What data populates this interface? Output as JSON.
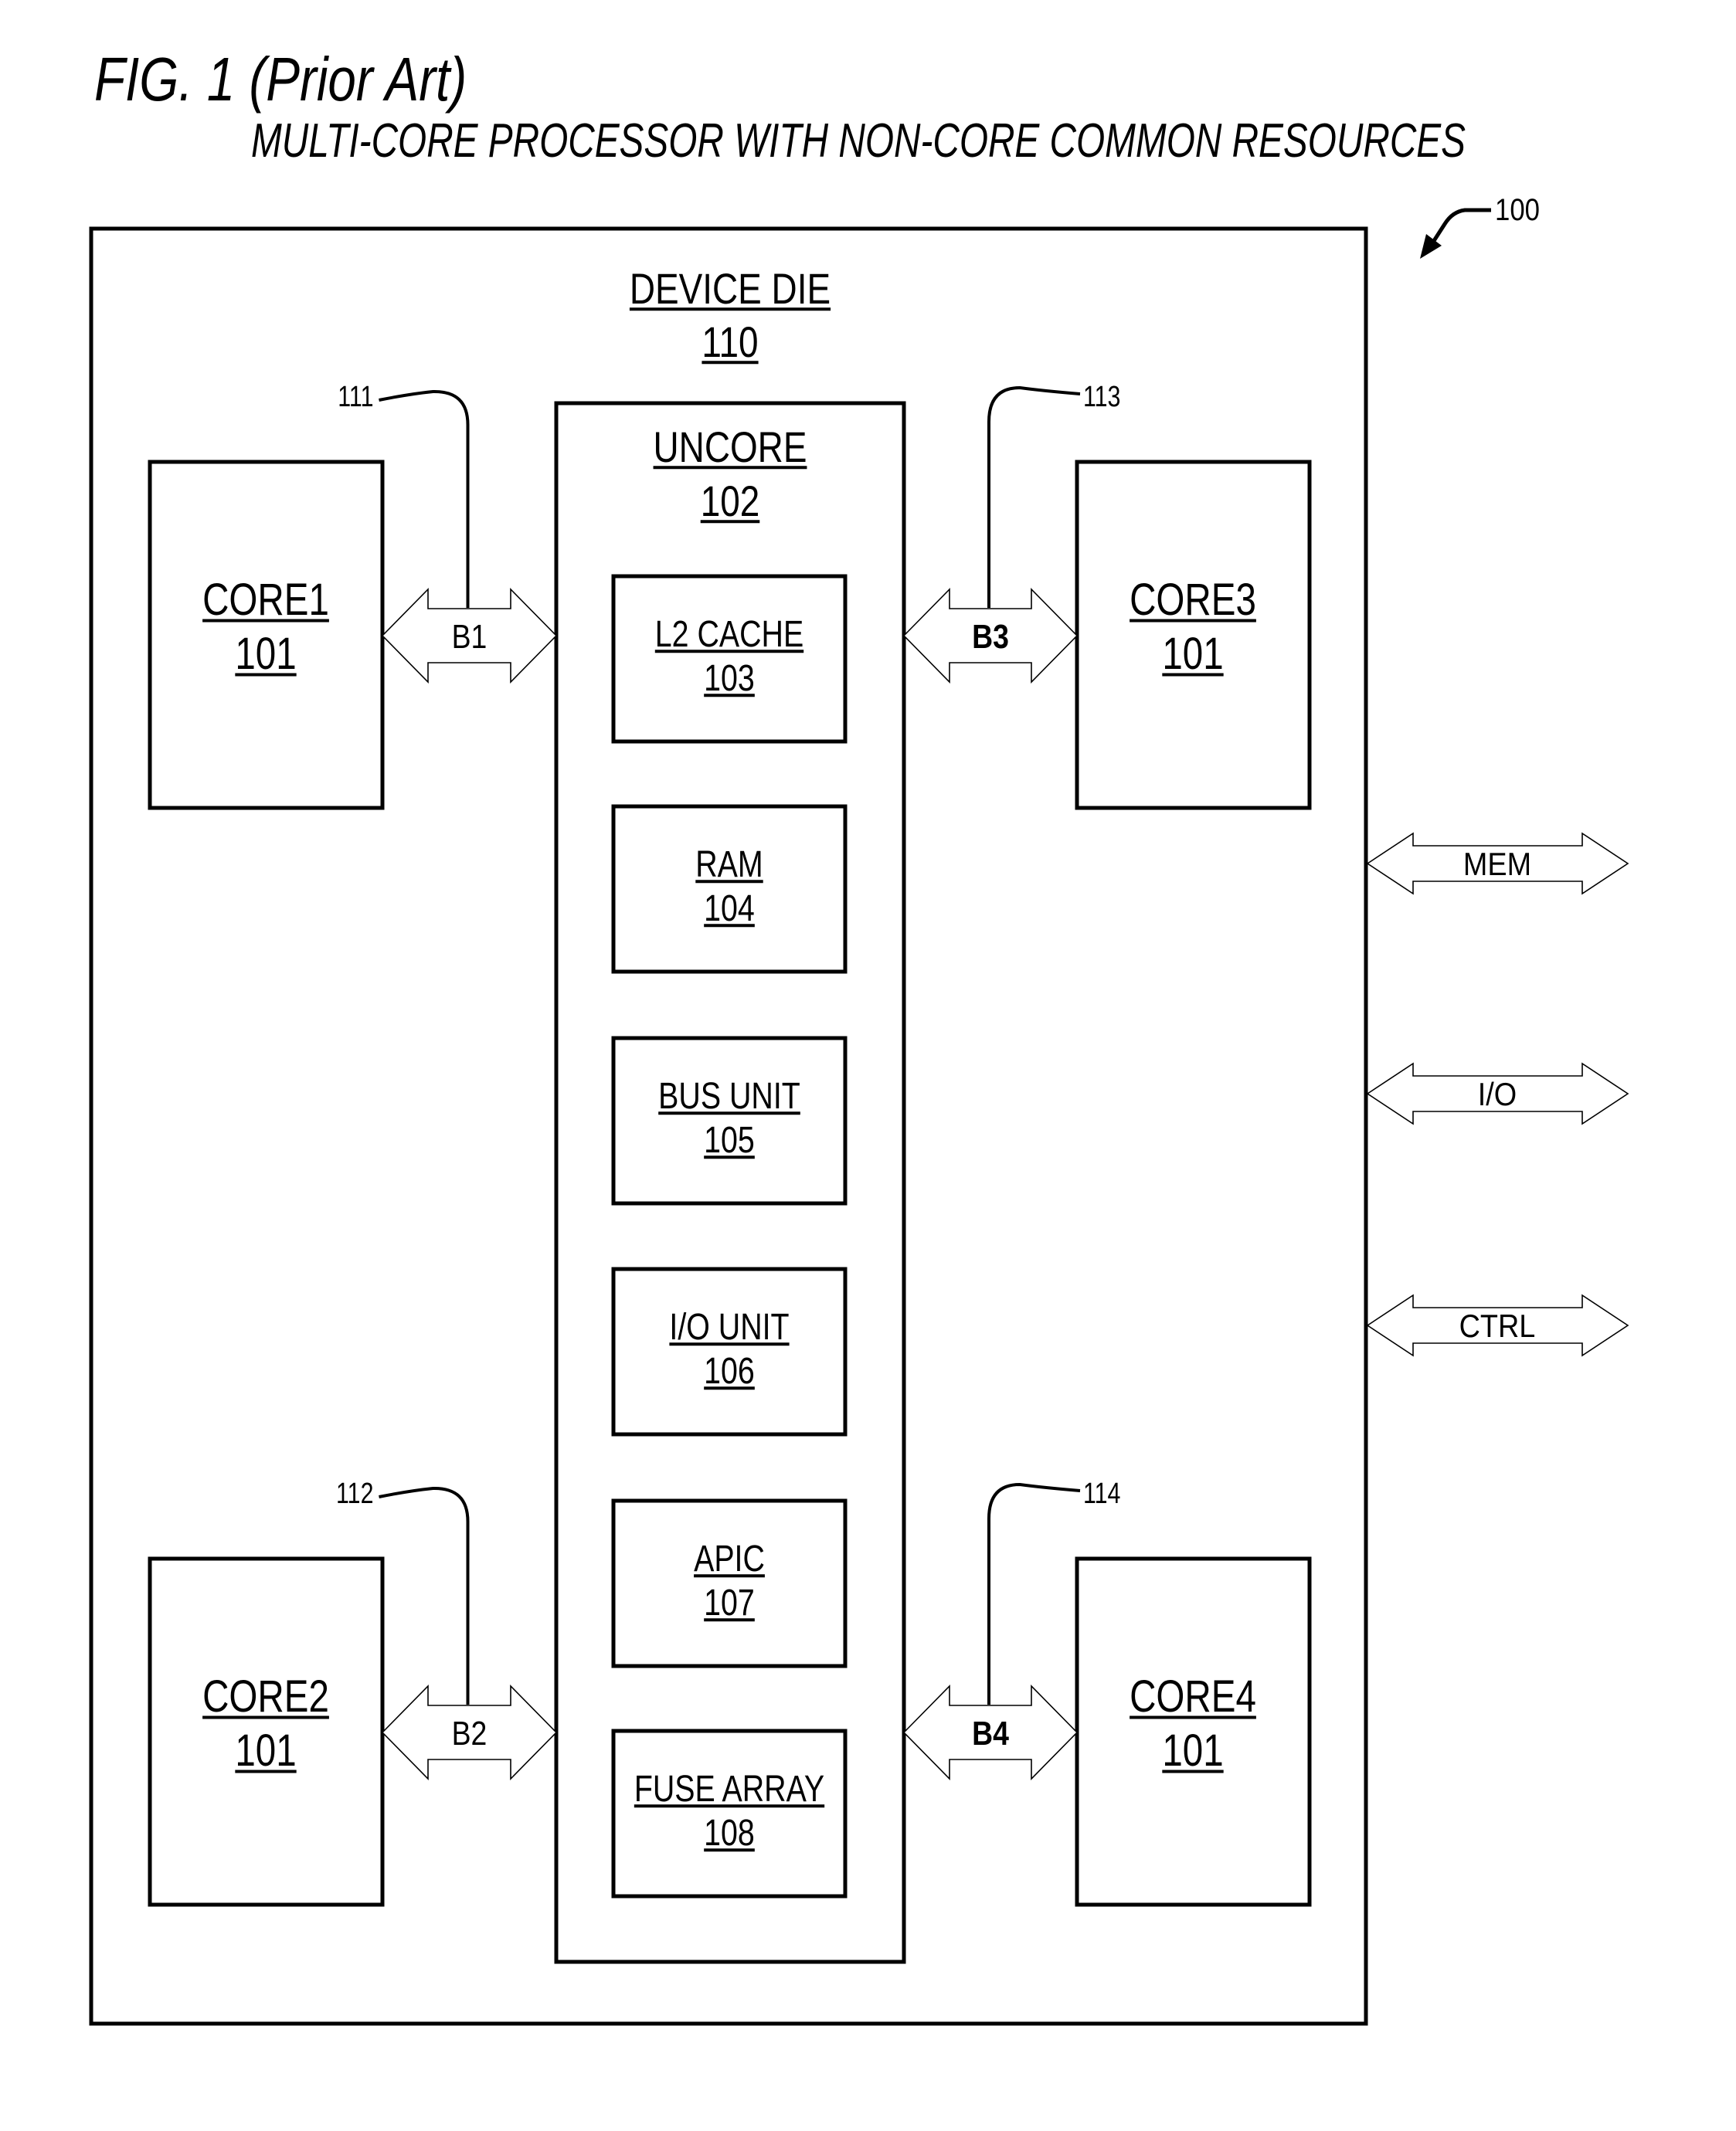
{
  "figure": {
    "title": "FIG. 1 (Prior Art)",
    "subtitle": "MULTI-CORE PROCESSOR WITH NON-CORE COMMON RESOURCES",
    "ref": "100"
  },
  "device_die": {
    "name": "DEVICE DIE",
    "ref": "110"
  },
  "uncore": {
    "name": "UNCORE",
    "ref": "102",
    "blocks": [
      {
        "name": "L2 CACHE",
        "ref": "103"
      },
      {
        "name": "RAM",
        "ref": "104"
      },
      {
        "name": "BUS UNIT",
        "ref": "105"
      },
      {
        "name": "I/O UNIT",
        "ref": "106"
      },
      {
        "name": "APIC",
        "ref": "107"
      },
      {
        "name": "FUSE ARRAY",
        "ref": "108"
      }
    ]
  },
  "cores": [
    {
      "name": "CORE1",
      "ref": "101"
    },
    {
      "name": "CORE2",
      "ref": "101"
    },
    {
      "name": "CORE3",
      "ref": "101"
    },
    {
      "name": "CORE4",
      "ref": "101"
    }
  ],
  "buses": [
    {
      "label": "B1",
      "ref": "111"
    },
    {
      "label": "B2",
      "ref": "112"
    },
    {
      "label": "B3",
      "ref": "113"
    },
    {
      "label": "B4",
      "ref": "114"
    }
  ],
  "external_buses": [
    {
      "label": "MEM"
    },
    {
      "label": "I/O"
    },
    {
      "label": "CTRL"
    }
  ]
}
